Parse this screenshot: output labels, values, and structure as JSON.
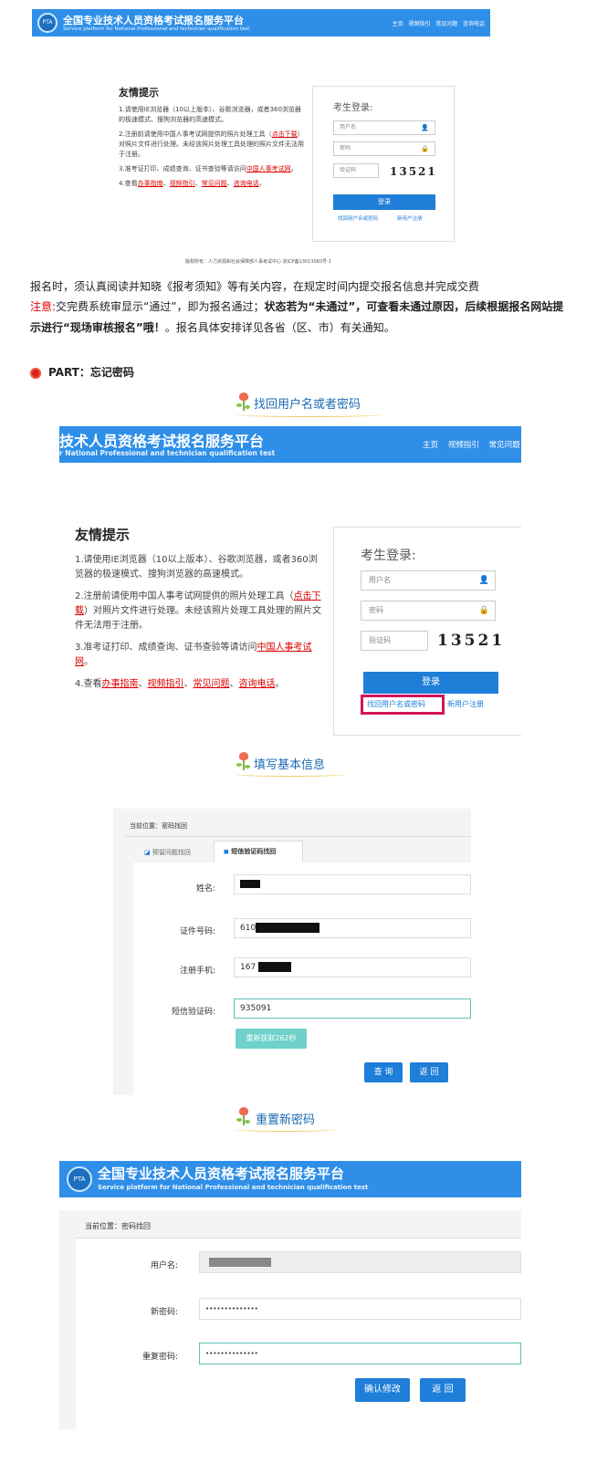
{
  "platform": {
    "title_cn": "全国专业技术人员资格考试报名服务平台",
    "title_en": "Service platform for National Professional and technician qualification test",
    "title_cn_cropped": "技术人员资格考试报名服务平台",
    "title_en_cropped": "r National Professional and technician qualification test",
    "logo_text": "PTA",
    "nav": [
      "主页",
      "视频指引",
      "常见问题",
      "咨询电话"
    ],
    "nav_cropped": [
      "主页",
      "视频指引",
      "常见问题"
    ]
  },
  "tips": {
    "title": "友情提示",
    "p1": "1.请使用IE浏览器（10以上版本）、谷歌浏览器，或者360浏览器的极速模式、搜狗浏览器的高速模式。",
    "p2a": "2.注册前请使用中国人事考试网提供的照片处理工具（",
    "p2link": "点击下载",
    "p2b": "）对照片文件进行处理。未经该照片处理工具处理的照片文件无法用于注册。",
    "p3a": "3.准考证打印、成绩查询、证书查验等请访问",
    "p3link": "中国人事考试网",
    "p3b": "。",
    "p4a": "4.查看",
    "p4links": [
      "办事指南",
      "视频指引",
      "常见问题",
      "咨询电话"
    ],
    "p4b": "。"
  },
  "login": {
    "title": "考生登录:",
    "user_placeholder": "用户名",
    "pwd_placeholder": "密码",
    "captcha_placeholder": "验证码",
    "captcha_value": "13521",
    "login_btn": "登录",
    "find_link": "找回用户名或密码",
    "register_link": "新用户注册"
  },
  "footer": "版权所有：人力资源和社会保障部人事考试中心 京ICP备13013060号-1",
  "article": {
    "para1": "报名时，须认真阅读并知晓《报考须知》等有关内容，在规定时间内提交报名信息并完成交费",
    "note_label": "注意:",
    "note_text1": "交完费系统审显示“通过”，即为报名通过；",
    "note_bold": "状态若为“未通过”，可查看未通过原因，后续根据报名网站提示进行“现场审核报名”哦！",
    "note_text2": "。报名具体安排详见各省（区、市）有关通知。",
    "part_label": "PART：忘记密码",
    "section1": "找回用户名或者密码",
    "section2": "填写基本信息",
    "section3": "重置新密码"
  },
  "recover": {
    "breadcrumb": "当前位置：密码找回",
    "tab1": "预留问题找回",
    "tab2": "短信验证码找回",
    "name_label": "姓名:",
    "id_label": "证件号码:",
    "id_prefix": "610",
    "phone_label": "注册手机:",
    "phone_prefix": "167",
    "sms_label": "短信验证码:",
    "sms_value": "935091",
    "resend_btn": "重新获取262秒",
    "query_btn": "查 询",
    "back_btn": "返 回"
  },
  "reset": {
    "breadcrumb": "当前位置：密码找回",
    "username_label": "用户名:",
    "newpwd_label": "新密码:",
    "newpwd_value": "••••••••••••••",
    "repeat_label": "重复密码:",
    "repeat_value": "••••••••••••••",
    "confirm_btn": "确认修改",
    "back_btn": "返 回"
  },
  "colors": {
    "brand_blue": "#2f8fe8",
    "button_blue": "#1e7ed8",
    "highlight": "#d4145a",
    "note_red": "#e60000"
  }
}
